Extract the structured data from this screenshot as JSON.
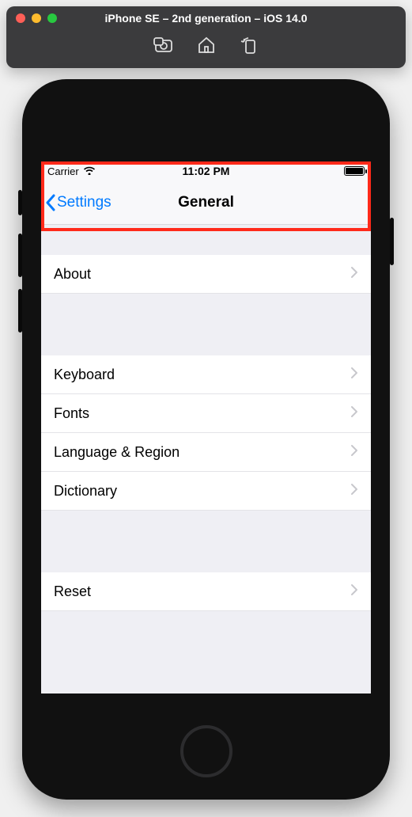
{
  "simulator": {
    "title": "iPhone SE – 2nd generation – iOS 14.0"
  },
  "statusbar": {
    "carrier": "Carrier",
    "time": "11:02 PM"
  },
  "nav": {
    "back_label": "Settings",
    "title": "General"
  },
  "groups": [
    {
      "spacer": "normal",
      "items": [
        {
          "label": "About"
        }
      ]
    },
    {
      "spacer": "big",
      "items": [
        {
          "label": "Keyboard"
        },
        {
          "label": "Fonts"
        },
        {
          "label": "Language & Region"
        },
        {
          "label": "Dictionary"
        }
      ]
    },
    {
      "spacer": "big",
      "items": [
        {
          "label": "Reset"
        }
      ]
    }
  ]
}
